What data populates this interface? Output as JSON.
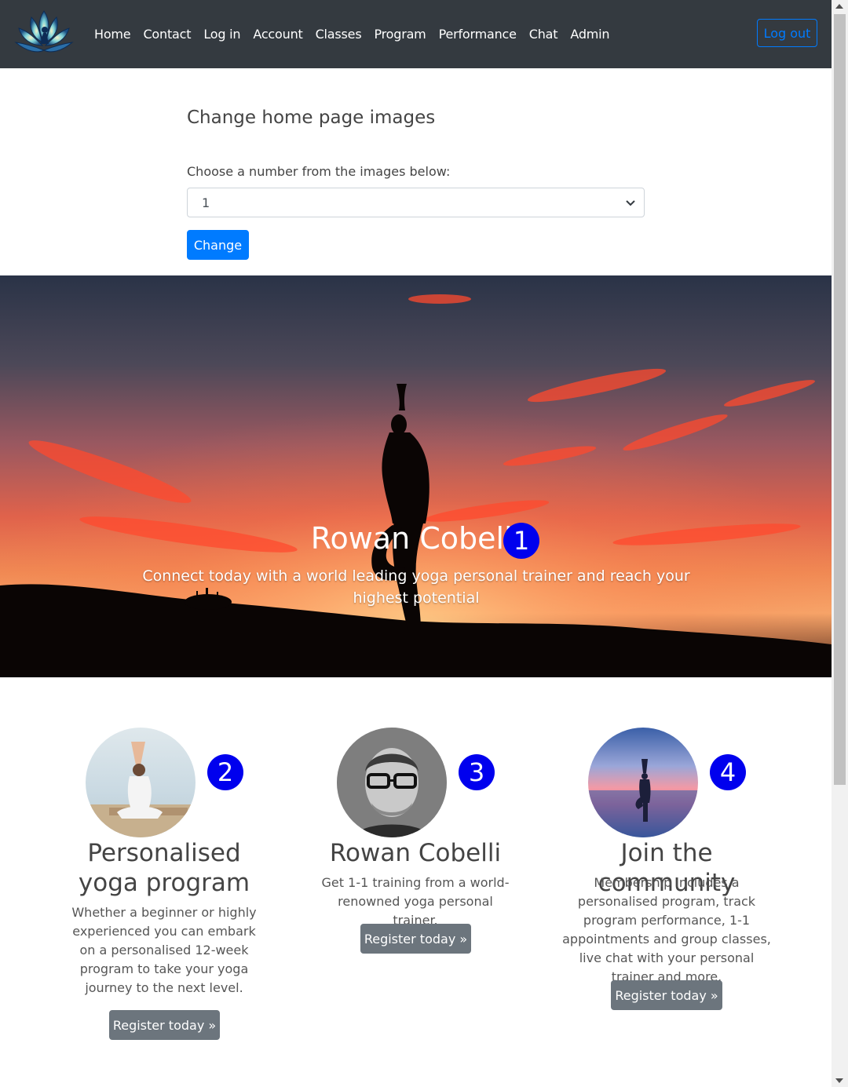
{
  "nav": {
    "items": [
      "Home",
      "Contact",
      "Log in",
      "Account",
      "Classes",
      "Program",
      "Performance",
      "Chat",
      "Admin"
    ],
    "logout_label": "Log out"
  },
  "form": {
    "title": "Change home page images",
    "label": "Choose a number from the images below:",
    "selected_value": "1",
    "submit_label": "Change"
  },
  "hero": {
    "title": "Rowan Cobelli",
    "subtitle": "Connect today with a world leading yoga personal trainer and reach your highest potential",
    "badge": "1"
  },
  "features": [
    {
      "badge": "2",
      "heading": "Personalised yoga program",
      "text": "Whether a beginner or highly experienced you can embark on a personalised 12-week program to take your yoga journey to the next level.",
      "button": "Register today »"
    },
    {
      "badge": "3",
      "heading": "Rowan Cobelli",
      "text": "Get 1-1 training from a world-renowned yoga personal trainer.",
      "button": "Register today »"
    },
    {
      "badge": "4",
      "heading": "Join the community",
      "text": "Membership includes a personalised program, track program performance, 1-1 appointments and group classes, live chat with your personal trainer and more.",
      "button": "Register today »"
    }
  ],
  "colors": {
    "navbar": "#343a40",
    "primary": "#007bff",
    "secondary": "#6c757d",
    "badge": "#0000ee"
  }
}
